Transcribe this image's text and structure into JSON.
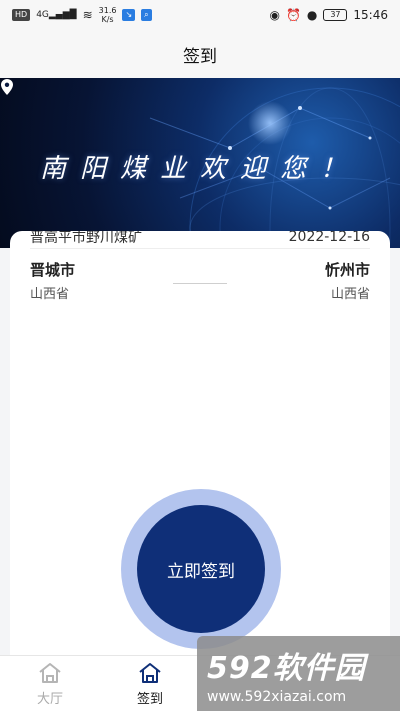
{
  "status_bar": {
    "left_network_badge": "HD",
    "left_signal_label": "4G",
    "speed_value": "31.6",
    "speed_unit": "K/s",
    "battery_level": "37",
    "time": "15:46"
  },
  "header": {
    "title": "签到"
  },
  "banner": {
    "welcome_text": "南阳煤业欢迎您！"
  },
  "card": {
    "top_left_text": "晋高平市野川煤矿",
    "top_right_date": "2022-12-16",
    "origin_city": "晋城市",
    "origin_province": "山西省",
    "destination_city": "忻州市",
    "destination_province": "山西省"
  },
  "sign_button": {
    "label": "立即签到"
  },
  "tabs": [
    {
      "label": "大厅",
      "icon": "home-icon",
      "active": false
    },
    {
      "label": "签到",
      "icon": "home-icon",
      "active": true
    }
  ],
  "watermark": {
    "brand": "592软件园",
    "url": "www.592xiazai.com"
  },
  "colors": {
    "sign_button": "#0f2f78",
    "sign_ring": "#b3c4ee",
    "banner_dark": "#071434"
  }
}
